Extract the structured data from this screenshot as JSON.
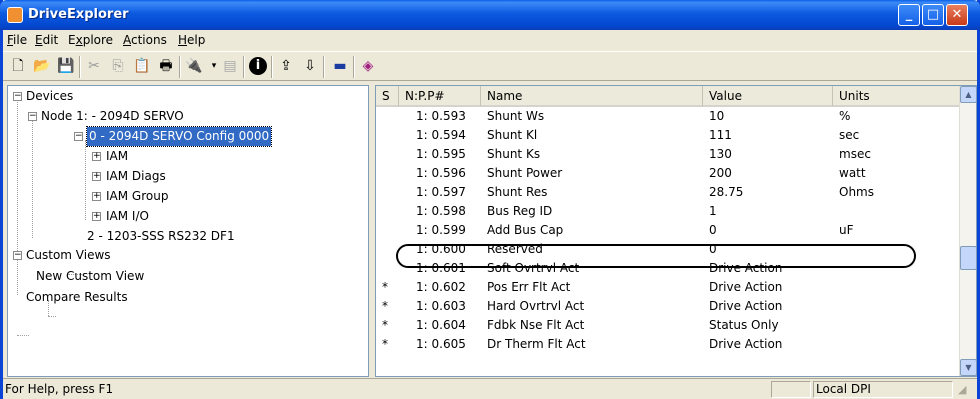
{
  "window": {
    "title": "DriveExplorer"
  },
  "menu": [
    {
      "label": "File",
      "mnemonic": "F"
    },
    {
      "label": "Edit",
      "mnemonic": "E"
    },
    {
      "label": "Explore",
      "mnemonic": "x"
    },
    {
      "label": "Actions",
      "mnemonic": "A"
    },
    {
      "label": "Help",
      "mnemonic": "H"
    }
  ],
  "toolbar_icons": [
    "new-icon",
    "open-icon",
    "save-icon",
    "cut-icon",
    "copy-icon",
    "paste-icon",
    "print-icon",
    "connect-icon",
    "dropdown-arrow-icon",
    "disabled-doc-icon",
    "info-icon",
    "upload-icon",
    "download-icon",
    "parameter-icon",
    "book-icon"
  ],
  "tree": {
    "root": "Devices",
    "node1": "Node 1: - 2094D SERVO",
    "config": "0  - 2094D SERVO Config 0000",
    "iam": "IAM",
    "iam_diags": "IAM Diags",
    "iam_group": "IAM Group",
    "iam_io": "IAM I/O",
    "df1": "2  - 1203-SSS RS232 DF1",
    "custom_views": "Custom Views",
    "new_custom_view": "New Custom View",
    "compare_results": "Compare Results"
  },
  "list": {
    "headers": {
      "s": "S",
      "npp": "N:P.P#",
      "name": "Name",
      "value": "Value",
      "units": "Units"
    },
    "rows": [
      {
        "s": "",
        "npp": "1: 0.593",
        "name": "Shunt Ws",
        "value": "10",
        "units": "%"
      },
      {
        "s": "",
        "npp": "1: 0.594",
        "name": "Shunt Kl",
        "value": "111",
        "units": "sec"
      },
      {
        "s": "",
        "npp": "1: 0.595",
        "name": "Shunt Ks",
        "value": "130",
        "units": "msec"
      },
      {
        "s": "",
        "npp": "1: 0.596",
        "name": "Shunt Power",
        "value": "200",
        "units": "watt"
      },
      {
        "s": "",
        "npp": "1: 0.597",
        "name": "Shunt Res",
        "value": "28.75",
        "units": "Ohms"
      },
      {
        "s": "",
        "npp": "1: 0.598",
        "name": "Bus Reg ID",
        "value": "1",
        "units": ""
      },
      {
        "s": "",
        "npp": "1: 0.599",
        "name": "Add Bus Cap",
        "value": "0",
        "units": "uF"
      },
      {
        "s": "",
        "npp": "1: 0.600",
        "name": "Reserved",
        "value": "0",
        "units": ""
      },
      {
        "s": "",
        "npp": "1: 0.601",
        "name": "Soft Ovrtrvl Act",
        "value": "Drive Action",
        "units": ""
      },
      {
        "s": "*",
        "npp": "1: 0.602",
        "name": "Pos Err Flt Act",
        "value": "Drive Action",
        "units": ""
      },
      {
        "s": "*",
        "npp": "1: 0.603",
        "name": "Hard Ovrtrvl Act",
        "value": "Drive Action",
        "units": ""
      },
      {
        "s": "*",
        "npp": "1: 0.604",
        "name": "Fdbk Nse Flt Act",
        "value": "Status Only",
        "units": ""
      },
      {
        "s": "*",
        "npp": "1: 0.605",
        "name": "Dr Therm Flt Act",
        "value": "Drive Action",
        "units": ""
      }
    ]
  },
  "status": {
    "help": "For Help, press F1",
    "mode": "Local DPI"
  }
}
